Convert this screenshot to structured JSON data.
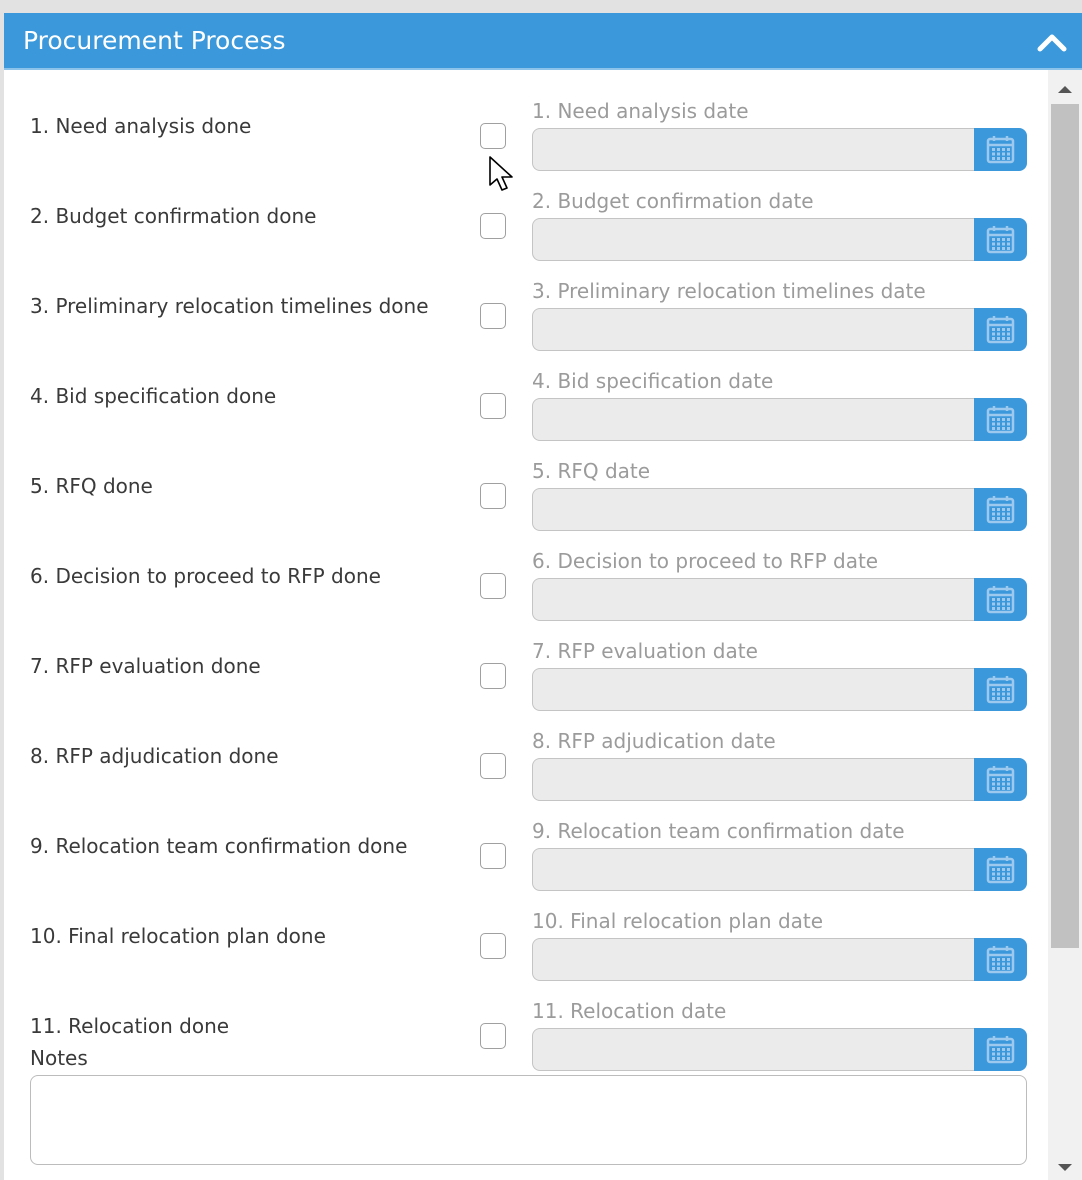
{
  "panel": {
    "title": "Procurement Process",
    "collapse_icon": "chevron-up-icon",
    "header_color": "#3a98db"
  },
  "steps": [
    {
      "done_label": "1. Need analysis done",
      "date_label": "1. Need analysis date",
      "checked": false,
      "date_value": ""
    },
    {
      "done_label": "2. Budget confirmation done",
      "date_label": "2. Budget confirmation date",
      "checked": false,
      "date_value": ""
    },
    {
      "done_label": "3. Preliminary relocation timelines done",
      "date_label": "3. Preliminary relocation timelines date",
      "checked": false,
      "date_value": ""
    },
    {
      "done_label": "4. Bid specification done",
      "date_label": "4. Bid specification date",
      "checked": false,
      "date_value": ""
    },
    {
      "done_label": "5. RFQ done",
      "date_label": "5. RFQ date",
      "checked": false,
      "date_value": ""
    },
    {
      "done_label": "6. Decision to proceed to RFP done",
      "date_label": "6. Decision to proceed to RFP date",
      "checked": false,
      "date_value": ""
    },
    {
      "done_label": "7. RFP evaluation done",
      "date_label": "7. RFP evaluation date",
      "checked": false,
      "date_value": ""
    },
    {
      "done_label": "8. RFP adjudication done",
      "date_label": "8. RFP adjudication date",
      "checked": false,
      "date_value": ""
    },
    {
      "done_label": "9. Relocation team confirmation done",
      "date_label": "9. Relocation team confirmation date",
      "checked": false,
      "date_value": ""
    },
    {
      "done_label": "10. Final relocation plan done",
      "date_label": "10. Final relocation plan date",
      "checked": false,
      "date_value": ""
    },
    {
      "done_label": "11. Relocation done",
      "date_label": "11. Relocation date",
      "checked": false,
      "date_value": ""
    }
  ],
  "notes": {
    "label": "Notes",
    "value": ""
  },
  "icons": {
    "calendar": "calendar-icon",
    "scroll_up": "scroll-up-arrow-icon",
    "scroll_down": "scroll-down-arrow-icon",
    "cursor": "mouse-pointer-icon"
  }
}
